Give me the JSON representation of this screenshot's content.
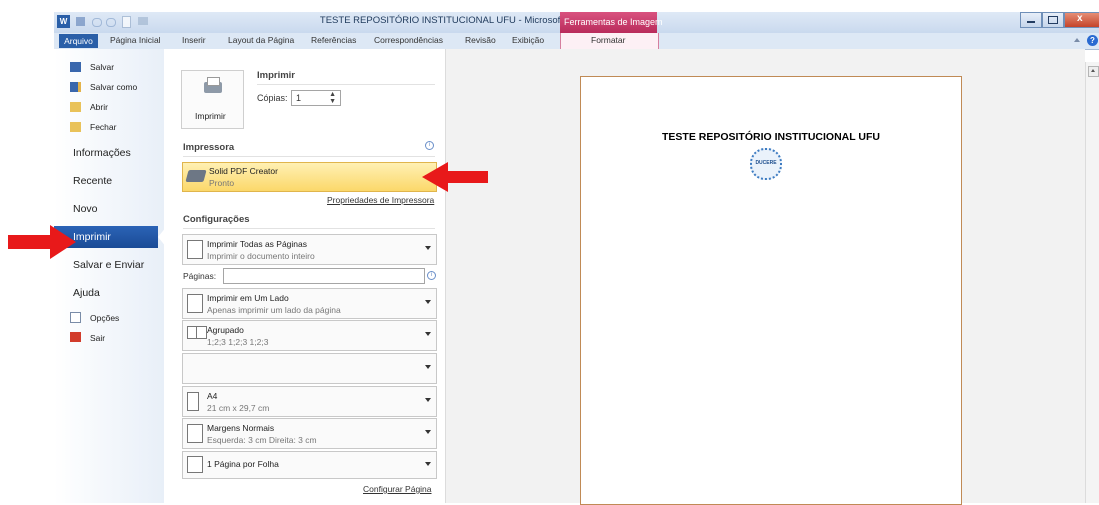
{
  "window": {
    "title": "TESTE REPOSITÓRIO INSTITUCIONAL UFU  -  Microsoft Word",
    "context_tab_title": "Ferramentas de Imagem"
  },
  "ribbon": {
    "tabs": [
      {
        "label": "Arquivo"
      },
      {
        "label": "Página Inicial"
      },
      {
        "label": "Inserir"
      },
      {
        "label": "Layout da Página"
      },
      {
        "label": "Referências"
      },
      {
        "label": "Correspondências"
      },
      {
        "label": "Revisão"
      },
      {
        "label": "Exibição"
      },
      {
        "label": "Formatar"
      }
    ]
  },
  "backstage_nav": {
    "small_items": [
      {
        "label": "Salvar",
        "icon": "save-icon"
      },
      {
        "label": "Salvar como",
        "icon": "save-as-icon"
      },
      {
        "label": "Abrir",
        "icon": "folder-open-icon"
      },
      {
        "label": "Fechar",
        "icon": "folder-close-icon"
      }
    ],
    "big_items": [
      {
        "label": "Informações"
      },
      {
        "label": "Recente"
      },
      {
        "label": "Novo"
      },
      {
        "label": "Imprimir"
      },
      {
        "label": "Salvar e Enviar"
      },
      {
        "label": "Ajuda"
      }
    ],
    "bottom_items": [
      {
        "label": "Opções",
        "icon": "options-icon"
      },
      {
        "label": "Sair",
        "icon": "exit-icon"
      }
    ],
    "selected": "Imprimir"
  },
  "print_panel": {
    "heading": "Imprimir",
    "print_button_label": "Imprimir",
    "copies_label": "Cópias:",
    "copies_value": "1",
    "printer_heading": "Impressora",
    "printer_name": "Solid PDF Creator",
    "printer_status": "Pronto",
    "printer_properties_link": "Propriedades de Impressora",
    "settings_heading": "Configurações",
    "settings": [
      {
        "line1": "Imprimir Todas as Páginas",
        "line2": "Imprimir o documento inteiro"
      },
      {
        "line1": "Imprimir em Um Lado",
        "line2": "Apenas imprimir um lado da página"
      },
      {
        "line1": "Agrupado",
        "line2": "1;2;3   1;2;3   1;2;3"
      },
      {
        "line1": "",
        "line2": ""
      },
      {
        "line1": "A4",
        "line2": "21 cm x 29,7 cm"
      },
      {
        "line1": "Margens Normais",
        "line2": "Esquerda:  3 cm   Direita:  3 cm"
      },
      {
        "line1": "1 Página por Folha",
        "line2": ""
      }
    ],
    "pages_label": "Páginas:",
    "pages_value": "",
    "page_setup_link": "Configurar Página"
  },
  "preview": {
    "document_title": "TESTE REPOSITÓRIO INSTITUCIONAL UFU",
    "logo_text": "DUCERE"
  },
  "colors": {
    "accent_blue": "#2a5fa8",
    "selected_printer_bg": "#fde58c",
    "context_tab": "#c2376a",
    "arrow_red": "#e8191a"
  }
}
